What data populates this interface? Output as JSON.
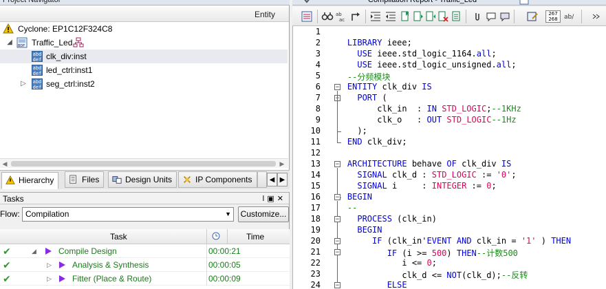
{
  "navigator": {
    "title": "Project Navigator",
    "column_header": "Entity",
    "device": "Cyclone: EP1C12F324C8",
    "project": "Traffic_Led",
    "instances": [
      {
        "label": "clk_div:inst",
        "selected": true
      },
      {
        "label": "led_ctrl:inst1",
        "selected": false
      },
      {
        "label": "seg_ctrl:inst2",
        "selected": false
      }
    ],
    "tabs": [
      "Hierarchy",
      "Files",
      "Design Units",
      "IP Components"
    ]
  },
  "tasks": {
    "title": "Tasks",
    "flow_label": "Flow:",
    "flow_value": "Compilation",
    "customize_label": "Customize...",
    "columns": {
      "task": "Task",
      "time": "Time"
    },
    "rows": [
      {
        "name": "Compile Design",
        "time": "00:00:21"
      },
      {
        "name": "Analysis & Synthesis",
        "time": "00:00:05"
      },
      {
        "name": "Fitter (Place & Route)",
        "time": "00:00:09"
      }
    ]
  },
  "report": {
    "title": "Compilation Report - Traffic_Led",
    "toolbar_badge": "267 268"
  },
  "code": {
    "line_numbers": [
      "1",
      "2",
      "3",
      "4",
      "5",
      "6",
      "7",
      "8",
      "9",
      "10",
      "11",
      "12",
      "13",
      "14",
      "15",
      "16",
      "17",
      "18",
      "19",
      "20",
      "21",
      "22",
      "23",
      "24"
    ]
  },
  "colors": {
    "keyword": "#0000e0",
    "type": "#e0005a",
    "comment": "#1a8a1a",
    "task_text": "#1a7a1a"
  }
}
